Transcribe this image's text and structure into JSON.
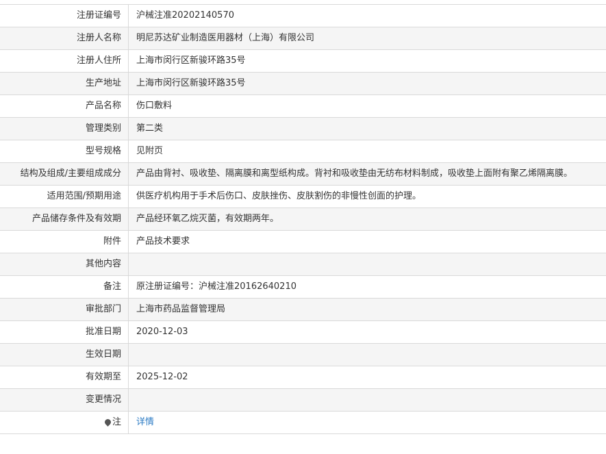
{
  "rows": [
    {
      "label": "注册证编号",
      "value": "沪械注准20202140570"
    },
    {
      "label": "注册人名称",
      "value": "明尼苏达矿业制造医用器材（上海）有限公司"
    },
    {
      "label": "注册人住所",
      "value": "上海市闵行区新骏环路35号"
    },
    {
      "label": "生产地址",
      "value": "上海市闵行区新骏环路35号"
    },
    {
      "label": "产品名称",
      "value": "伤口敷料"
    },
    {
      "label": "管理类别",
      "value": "第二类"
    },
    {
      "label": "型号规格",
      "value": "见附页"
    },
    {
      "label": "结构及组成/主要组成成分",
      "value": "产品由背衬、吸收垫、隔离膜和离型纸构成。背衬和吸收垫由无纺布材料制成，吸收垫上面附有聚乙烯隔离膜。"
    },
    {
      "label": "适用范围/预期用途",
      "value": "供医疗机构用于手术后伤口、皮肤挫伤、皮肤割伤的非慢性创面的护理。"
    },
    {
      "label": "产品储存条件及有效期",
      "value": "产品经环氧乙烷灭菌，有效期两年。"
    },
    {
      "label": "附件",
      "value": "产品技术要求"
    },
    {
      "label": "其他内容",
      "value": ""
    },
    {
      "label": "备注",
      "value": "原注册证编号：沪械注准20162640210"
    },
    {
      "label": "审批部门",
      "value": "上海市药品监督管理局"
    },
    {
      "label": "批准日期",
      "value": "2020-12-03"
    },
    {
      "label": "生效日期",
      "value": ""
    },
    {
      "label": "有效期至",
      "value": "2025-12-02"
    },
    {
      "label": "变更情况",
      "value": ""
    }
  ],
  "note_row": {
    "label": "注",
    "icon": "pin-icon",
    "link_text": "详情",
    "link_color": "#2b7bc4"
  }
}
